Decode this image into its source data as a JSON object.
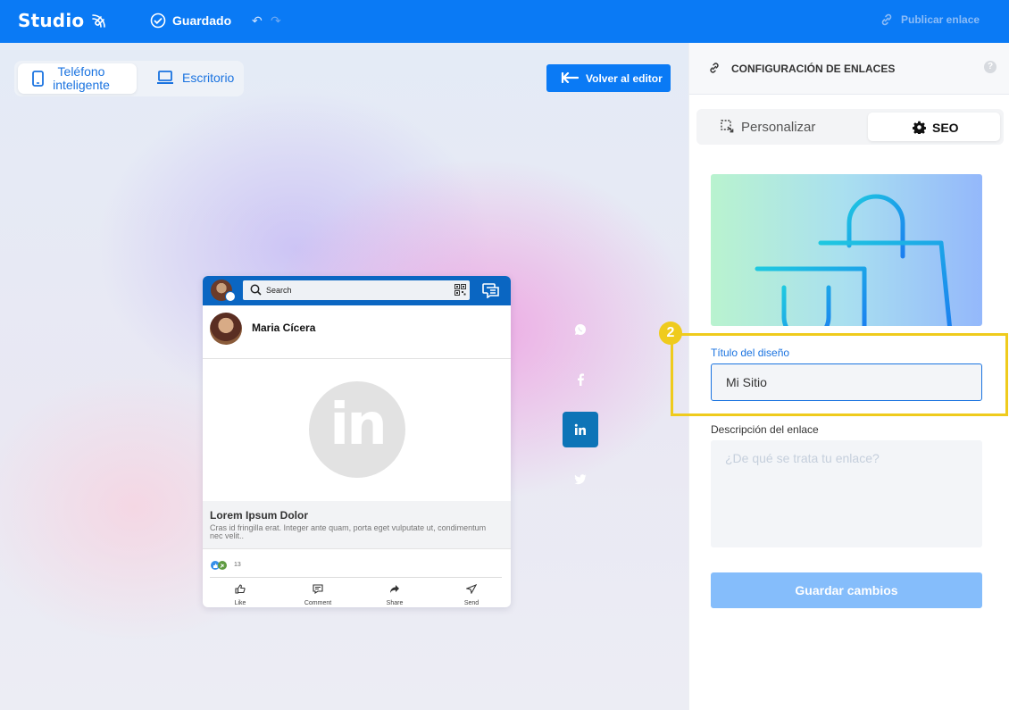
{
  "topbar": {
    "logo": "Studio",
    "saved_label": "Guardado",
    "undo_icon": "undo-icon",
    "redo_icon": "redo-icon",
    "publish_label": "Publicar enlace"
  },
  "canvas": {
    "device_toggle": {
      "phone_label": "Teléfono inteligente",
      "desktop_label": "Escritorio",
      "selected": "phone"
    },
    "back_button_label": "Volver al editor"
  },
  "preview": {
    "search_placeholder": "Search",
    "user_name": "Maria Cícera",
    "image_logo_text": "in",
    "link_title": "Lorem Ipsum Dolor",
    "link_description": "Cras id fringilla erat. Integer ante quam, porta eget vulputate ut, condimentum nec velit..",
    "reaction_count": "13",
    "actions": [
      {
        "label": "Like",
        "icon": "like-icon"
      },
      {
        "label": "Comment",
        "icon": "comment-icon"
      },
      {
        "label": "Share",
        "icon": "share-icon"
      },
      {
        "label": "Send",
        "icon": "send-icon"
      }
    ]
  },
  "share_buttons": [
    {
      "network": "whatsapp",
      "icon": "whatsapp-icon",
      "active": false
    },
    {
      "network": "facebook",
      "icon": "facebook-icon",
      "active": false
    },
    {
      "network": "linkedin",
      "icon": "linkedin-icon",
      "active": true,
      "color": "#0d74b7"
    },
    {
      "network": "twitter",
      "icon": "twitter-icon",
      "active": false
    }
  ],
  "panel": {
    "title": "CONFIGURACIÓN DE ENLACES",
    "help": "?",
    "tabs": [
      {
        "label": "Personalizar",
        "icon": "customize-icon",
        "active": false
      },
      {
        "label": "SEO",
        "icon": "gear-icon",
        "active": true
      }
    ],
    "step_badge": "2",
    "title_label": "Título del diseño",
    "title_value": "Mi Sitio",
    "description_label": "Descripción del enlace",
    "description_placeholder": "¿De qué se trata tu enlace?",
    "save_label": "Guardar cambios"
  },
  "colors": {
    "primary": "#0a7af5",
    "highlight": "#efcb1d",
    "linkedin": "#0a66c2",
    "save_disabled": "#85bdfb"
  }
}
